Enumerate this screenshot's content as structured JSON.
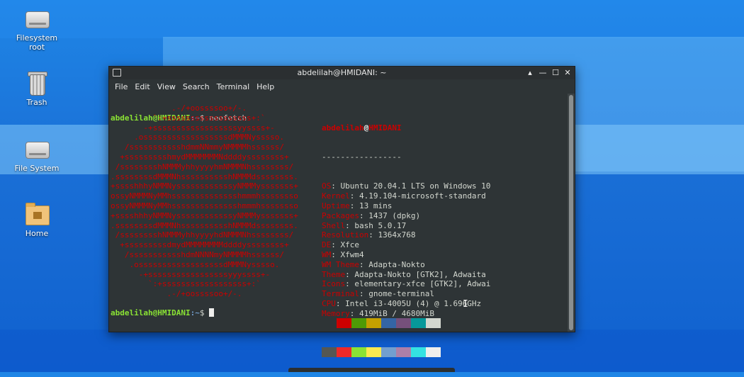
{
  "desktop": {
    "icons": [
      {
        "label_line1": "Filesystem",
        "label_line2": "root",
        "icon": "drive-icon"
      },
      {
        "label_line1": "Trash",
        "label_line2": "",
        "icon": "trash-icon"
      },
      {
        "label_line1": "File System",
        "label_line2": "",
        "icon": "drive-icon"
      },
      {
        "label_line1": "Home",
        "label_line2": "",
        "icon": "home-folder-icon"
      }
    ]
  },
  "window": {
    "title": "abdelilah@HMIDANI: ~",
    "buttons": {
      "shade": "▴",
      "minimize": "—",
      "maximize": "☐",
      "close": "✕"
    },
    "menu": [
      "File",
      "Edit",
      "View",
      "Search",
      "Terminal",
      "Help"
    ]
  },
  "terminal": {
    "prompt_user": "abdelilah@HMIDANI",
    "prompt_path": ":~",
    "prompt_symbol": "$ ",
    "command": "neofetch",
    "logo_lines": [
      "             .-/+oossssoo+/-.",
      "         `:+ssssssssssssssssss+:`",
      "       -+ssssssssssssssssssyyssss+-",
      "     .ossssssssssssssssssdMMMNysssso.",
      "   /ssssssssssshdmmNNmmyNMMMMhssssss/",
      "  +ssssssssshmydMMMMMMMNddddyssssssss+",
      " /sssssssshNMMMyhhyyyyhmNMMMNhssssssss/",
      ".ssssssssdMMMNhsssssssssshNMMMdssssssss.",
      "+sssshhhyNMMNyssssssssssssyNMMMysssssss+",
      "ossyNMMMNyMMhsssssssssssssshmmmhssssssso",
      "ossyNMMMNyMMhsssssssssssssshmmmhssssssso",
      "+sssshhhyNMMNyssssssssssssyNMMMysssssss+",
      ".ssssssssdMMMNhsssssssssshNMMMdssssssss.",
      " /sssssssshNMMMyhhyyyyhdNMMMNhssssssss/",
      "  +sssssssssdmydMMMMMMMMddddyssssssss+",
      "   /ssssssssssshdmNNNNmyNMMMMhssssss/",
      "    .ossssssssssssssssssdMMMNysssso.",
      "      -+sssssssssssssssssyyyssss+-",
      "        `:+ssssssssssssssssss+:`",
      "            .-/+oossssoo+/-."
    ],
    "info": {
      "user": "abdelilah",
      "at": "@",
      "host": "HMIDANI",
      "separator": "-----------------",
      "rows": [
        {
          "key": "OS",
          "value": ": Ubuntu 20.04.1 LTS on Windows 10"
        },
        {
          "key": "Kernel",
          "value": ": 4.19.104-microsoft-standard"
        },
        {
          "key": "Uptime",
          "value": ": 13 mins"
        },
        {
          "key": "Packages",
          "value": ": 1437 (dpkg)"
        },
        {
          "key": "Shell",
          "value": ": bash 5.0.17"
        },
        {
          "key": "Resolution",
          "value": ": 1364x768"
        },
        {
          "key": "DE",
          "value": ": Xfce"
        },
        {
          "key": "WM",
          "value": ": Xfwm4"
        },
        {
          "key": "WM Theme",
          "value": ": Adapta-Nokto"
        },
        {
          "key": "Theme",
          "value": ": Adapta-Nokto [GTK2], Adwaita"
        },
        {
          "key": "Icons",
          "value": ": elementary-xfce [GTK2], Adwai"
        },
        {
          "key": "Terminal",
          "value": ": gnome-terminal"
        },
        {
          "key": "CPU",
          "value": ": Intel i3-4005U (4) @ 1.696GHz"
        },
        {
          "key": "Memory",
          "value": ": 419MiB / 4680MiB"
        }
      ]
    },
    "palette": {
      "normal": [
        "#2e3436",
        "#cc0000",
        "#4e9a06",
        "#c4a000",
        "#3465a4",
        "#75507b",
        "#06989a",
        "#d3d7cf"
      ],
      "bright": [
        "#555753",
        "#ef2929",
        "#8ae234",
        "#fce94f",
        "#729fcf",
        "#ad7fa8",
        "#34e2e2",
        "#eeeeec"
      ]
    }
  }
}
